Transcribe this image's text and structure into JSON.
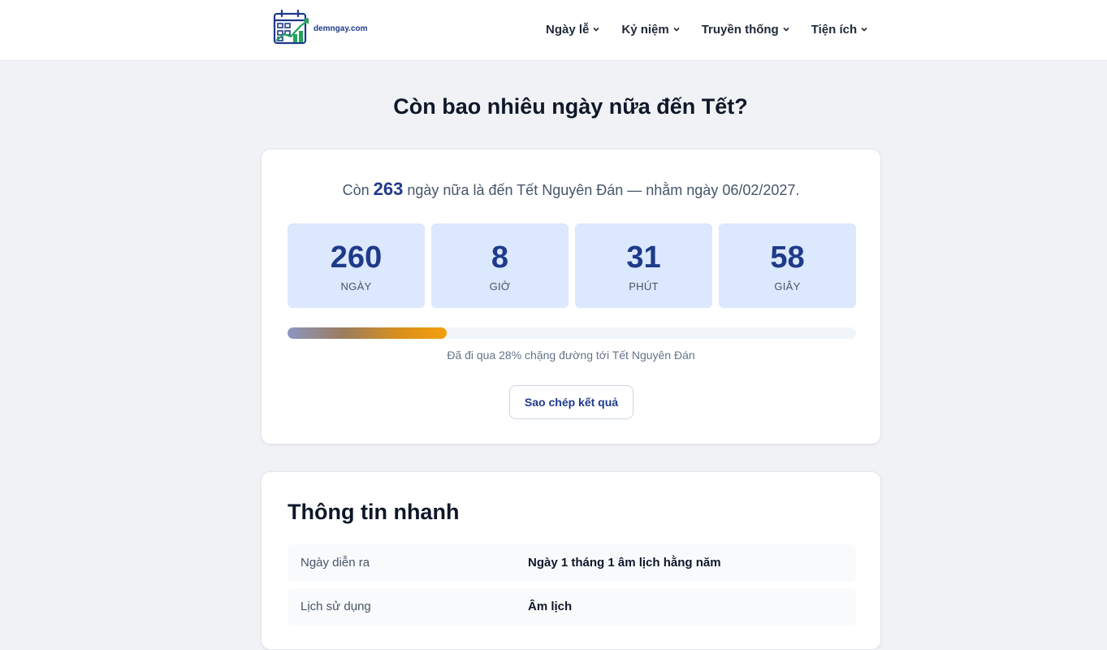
{
  "header": {
    "logo_text": "demngay.com",
    "nav": [
      {
        "label": "Ngày lễ"
      },
      {
        "label": "Kỷ niệm"
      },
      {
        "label": "Truyền thống"
      },
      {
        "label": "Tiện ích"
      }
    ]
  },
  "page_title": "Còn bao nhiêu ngày nữa đến Tết?",
  "countdown": {
    "summary_prefix": "Còn",
    "summary_days": "263",
    "summary_suffix": "ngày nữa là đến Tết Nguyên Đán — nhằm ngày 06/02/2027.",
    "units": [
      {
        "value": "260",
        "label": "NGÀY"
      },
      {
        "value": "8",
        "label": "GIỜ"
      },
      {
        "value": "31",
        "label": "PHÚT"
      },
      {
        "value": "58",
        "label": "GIÂY"
      }
    ],
    "progress_percent": 28,
    "progress_text": "Đã đi qua 28% chặng đường tới Tết Nguyên Đán",
    "copy_button": "Sao chép kết quả"
  },
  "quick_info": {
    "title": "Thông tin nhanh",
    "rows": [
      {
        "label": "Ngày diễn ra",
        "value": "Ngày 1 tháng 1 âm lịch hằng năm"
      },
      {
        "label": "Lịch sử dụng",
        "value": "Âm lịch"
      }
    ]
  },
  "colors": {
    "accent": "#1e3a8a",
    "box_bg": "#dbe8fd",
    "progress_end": "#f59e0b",
    "page_bg": "#f0f2f5"
  }
}
